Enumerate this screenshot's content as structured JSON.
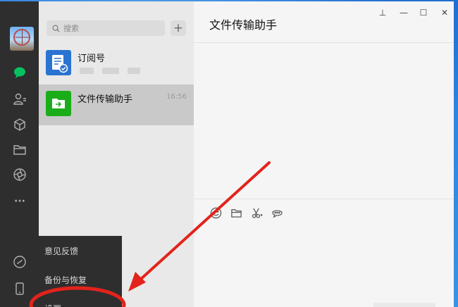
{
  "rail": {
    "items": [
      {
        "icon": "chat-bubble-icon",
        "active": true
      },
      {
        "icon": "contacts-icon",
        "active": false
      },
      {
        "icon": "cube-icon",
        "active": false
      },
      {
        "icon": "folder-icon",
        "active": false
      },
      {
        "icon": "aperture-icon",
        "active": false
      },
      {
        "icon": "more-icon",
        "active": false
      }
    ],
    "bottom": [
      {
        "icon": "mini-program-icon"
      },
      {
        "icon": "phone-icon"
      }
    ],
    "more_glyph": "···",
    "accent": "#07c160"
  },
  "search": {
    "placeholder": "搜索",
    "add_glyph": "+"
  },
  "chats": [
    {
      "name": "订阅号",
      "time": "",
      "icon": "subscription-icon",
      "icon_color": "#2a74d1",
      "selected": false
    },
    {
      "name": "文件传输助手",
      "time": "16:56",
      "icon": "file-transfer-icon",
      "icon_color": "#1aad19",
      "selected": true
    }
  ],
  "pane": {
    "title": "文件传输助手",
    "controls": [
      "pin-icon",
      "minimize-icon",
      "maximize-icon",
      "close-icon"
    ],
    "control_glyphs": {
      "pin": "⊥",
      "minimize": "—",
      "maximize": "☐",
      "close": "✕"
    }
  },
  "composer_tools": [
    "emoji-icon",
    "folder-icon",
    "scissors-icon",
    "chat-history-icon"
  ],
  "menu": {
    "items": [
      "意见反馈",
      "备份与恢复",
      "设置"
    ]
  },
  "annotation": {
    "color": "#e3231b"
  }
}
